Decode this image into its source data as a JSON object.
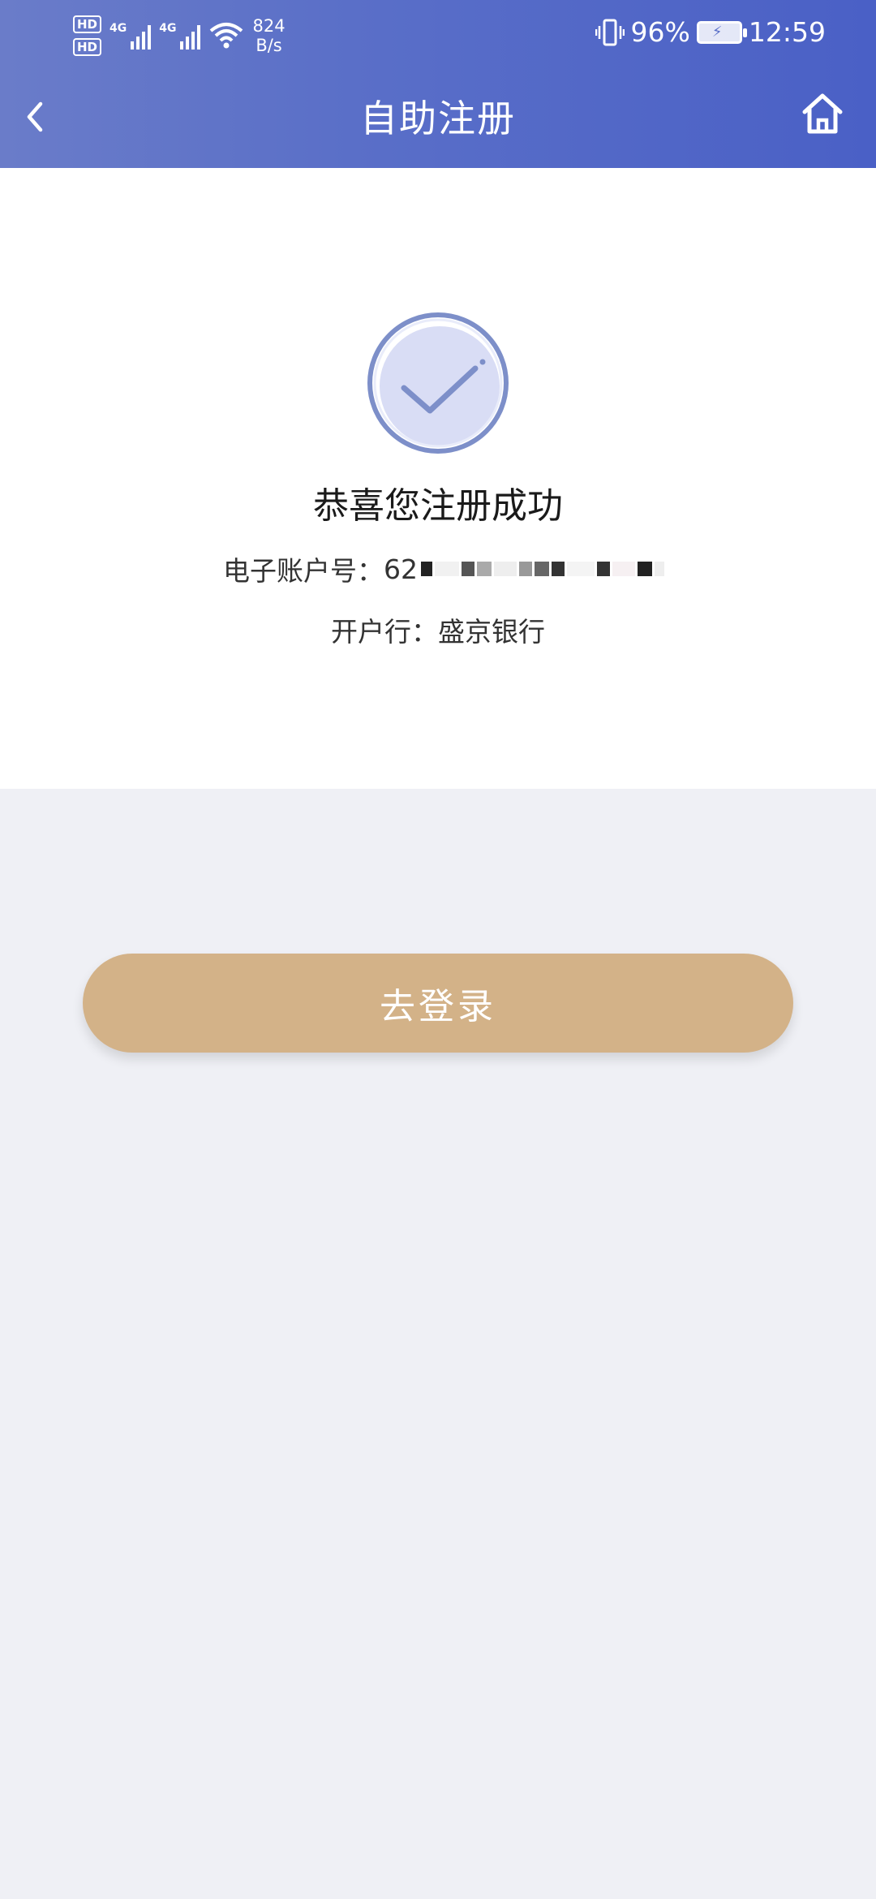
{
  "status_bar": {
    "hd1": "HD",
    "hd2": "HD",
    "net1": "4G",
    "net2": "4G",
    "speed_value": "824",
    "speed_unit": "B/s",
    "battery": "96%",
    "time": "12:59"
  },
  "header": {
    "title": "自助注册",
    "back_icon": "chevron-left-icon",
    "home_icon": "home-icon",
    "gradient_colors": [
      "#6a7cc9",
      "#4a60c6"
    ]
  },
  "result": {
    "icon": "check-circle-icon",
    "message": "恭喜您注册成功",
    "account_label": "电子账户号：",
    "account_number_visible": "62",
    "bank_label": "开户行：",
    "bank_name": "盛京银行"
  },
  "actions": {
    "login_label": "去登录",
    "button_color": "#d3b288"
  }
}
